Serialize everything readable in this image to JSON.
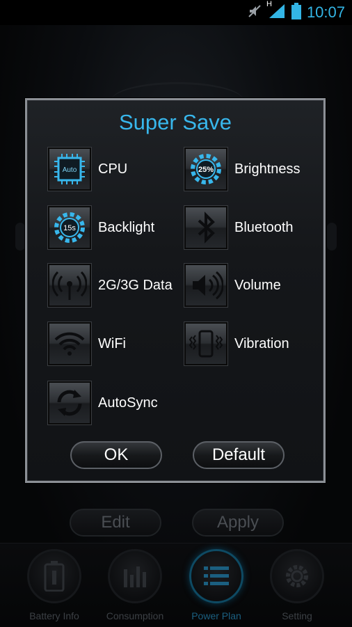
{
  "status_bar": {
    "time": "10:07",
    "network_label": "H"
  },
  "dialog": {
    "title": "Super Save",
    "options": [
      {
        "label": "CPU",
        "icon": "cpu-icon",
        "icon_text": "Auto"
      },
      {
        "label": "Brightness",
        "icon": "brightness-icon",
        "icon_text": "25%"
      },
      {
        "label": "Backlight",
        "icon": "backlight-timer-icon",
        "icon_text": "15s"
      },
      {
        "label": "Bluetooth",
        "icon": "bluetooth-icon"
      },
      {
        "label": "2G/3G Data",
        "icon": "mobile-data-icon"
      },
      {
        "label": "Volume",
        "icon": "volume-icon"
      },
      {
        "label": "WiFi",
        "icon": "wifi-icon"
      },
      {
        "label": "Vibration",
        "icon": "vibration-icon"
      },
      {
        "label": "AutoSync",
        "icon": "sync-icon"
      }
    ],
    "ok_label": "OK",
    "default_label": "Default"
  },
  "background": {
    "edit_label": "Edit",
    "apply_label": "Apply"
  },
  "tabs": [
    {
      "label": "Battery Info",
      "icon": "battery-icon",
      "active": false
    },
    {
      "label": "Consumption",
      "icon": "bar-chart-icon",
      "active": false
    },
    {
      "label": "Power Plan",
      "icon": "list-icon",
      "active": true
    },
    {
      "label": "Setting",
      "icon": "gear-icon",
      "active": false
    }
  ],
  "colors": {
    "accent": "#38b7ec",
    "background": "#050607",
    "text": "#ffffff"
  }
}
